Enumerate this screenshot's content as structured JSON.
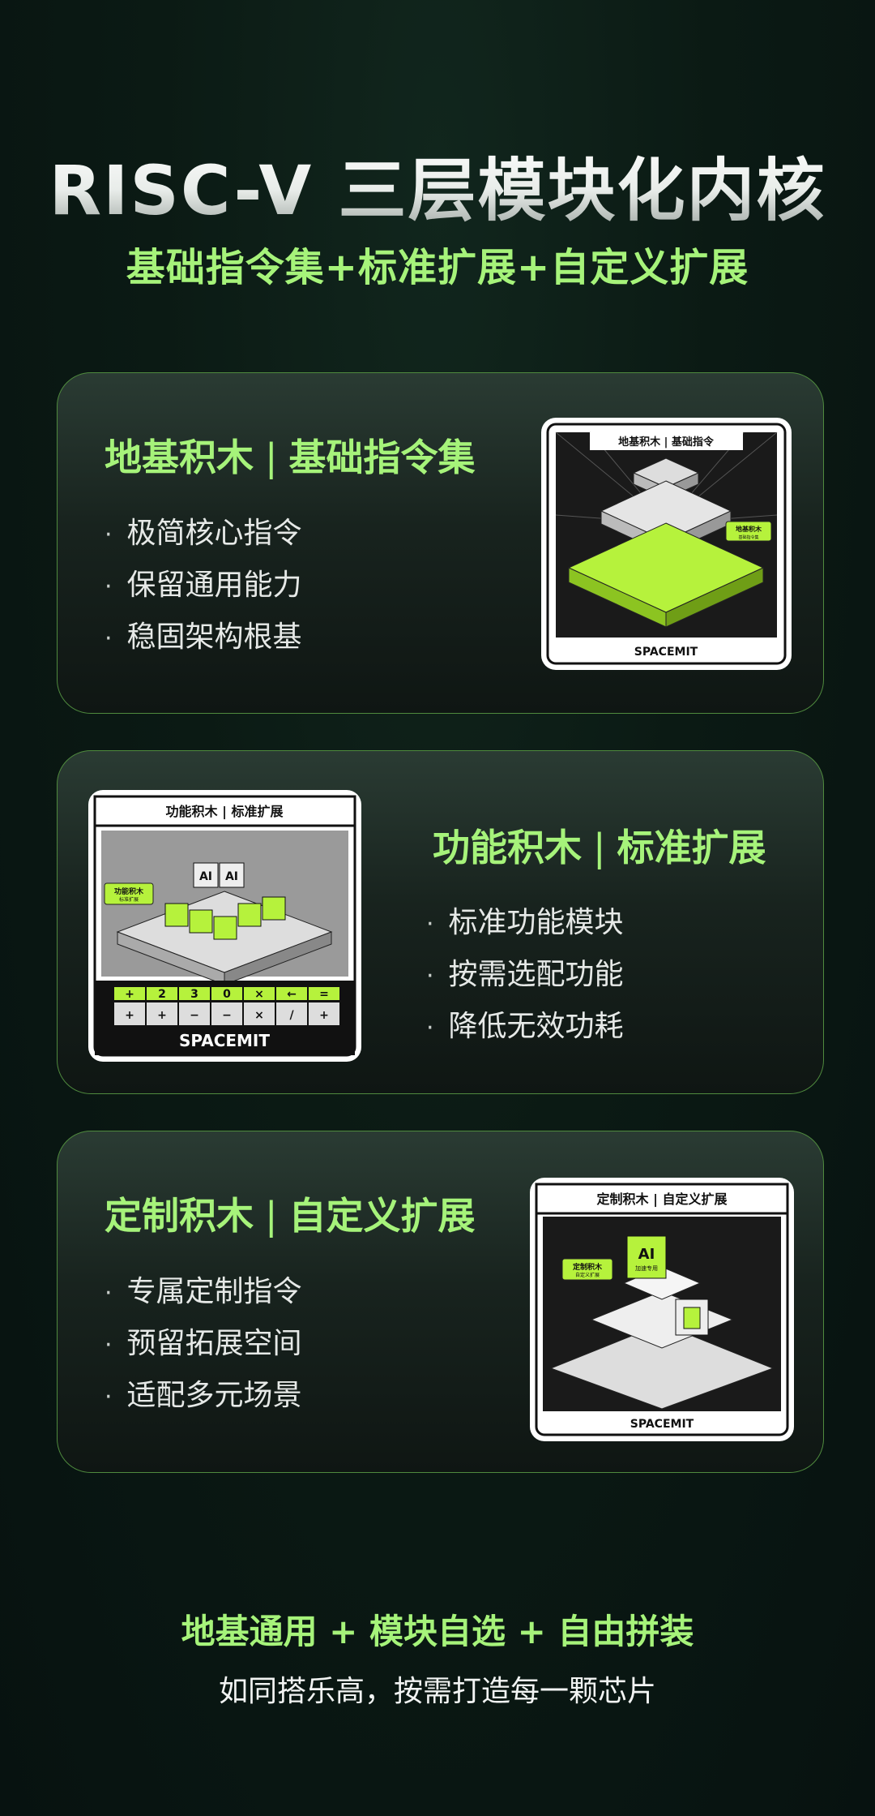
{
  "header": {
    "title": "RISC-V 三层模块化内核",
    "subtitle": "基础指令集+标准扩展+自定义扩展"
  },
  "cards": [
    {
      "title_a": "地基积木",
      "title_sep": "|",
      "title_b": "基础指令集",
      "bullets": [
        "极简核心指令",
        "保留通用能力",
        "稳固架构根基"
      ],
      "image": {
        "header": "地基积木 | 基础指令",
        "tag": "地基积木",
        "tag_sub": "基础指令集",
        "brand": "SPACEMIT"
      }
    },
    {
      "title_a": "功能积木",
      "title_sep": "|",
      "title_b": "标准扩展",
      "bullets": [
        "标准功能模块",
        "按需选配功能",
        "降低无效功耗"
      ],
      "image": {
        "header": "功能积木 | 标准扩展",
        "tag": "功能积木",
        "tag_sub": "标准扩展",
        "brand": "SPACEMIT",
        "block_labels": [
          "AI",
          "AI"
        ],
        "key_row": [
          "+",
          "2",
          "3",
          "0",
          "×",
          "←",
          "="
        ],
        "key_row2": [
          "+",
          "+",
          "−",
          "−",
          "×",
          "/",
          "+"
        ]
      }
    },
    {
      "title_a": "定制积木",
      "title_sep": "|",
      "title_b": "自定义扩展",
      "bullets": [
        "专属定制指令",
        "预留拓展空间",
        "适配多元场景"
      ],
      "image": {
        "header": "定制积木 | 自定义扩展",
        "tag": "定制积木",
        "tag_sub": "自定义扩展",
        "brand": "SPACEMIT",
        "block_label": "AI",
        "block_sub": "加速专用"
      }
    }
  ],
  "footer": {
    "line1": "地基通用 + 模块自选 + 自由拼装",
    "line2": "如同搭乐高，按需打造每一颗芯片"
  },
  "colors": {
    "accent": "#a6f37a",
    "background": "#0b1a14",
    "card_border": "#4f8a3e"
  }
}
